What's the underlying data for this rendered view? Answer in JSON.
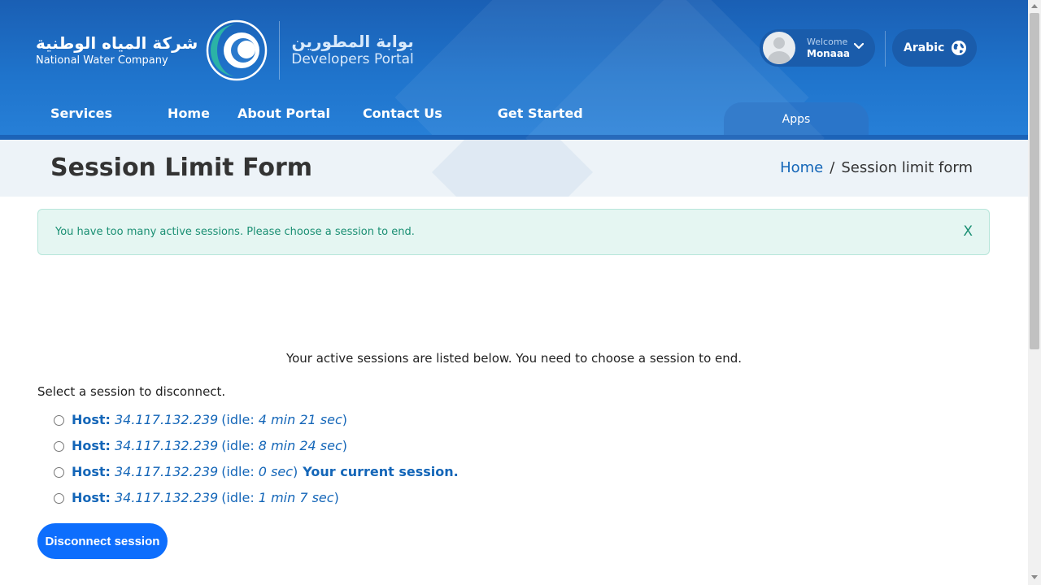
{
  "header": {
    "logo": {
      "company_ar": "شركة المياه الوطنية",
      "company_en": "National Water Company",
      "portal_ar": "بوابة المطورين",
      "portal_en": "Developers Portal"
    },
    "user": {
      "welcome": "Welcome",
      "name": "Monaaa",
      "icon": "chevron-down-icon"
    },
    "language": {
      "label": "Arabic",
      "icon": "globe-icon"
    },
    "nav": [
      "Services",
      "Home",
      "About Portal",
      "Contact Us",
      "Get Started"
    ],
    "apps_tab": "Apps"
  },
  "title_band": {
    "title": "Session Limit Form",
    "breadcrumb": {
      "home": "Home",
      "separator": "/",
      "current": "Session limit form"
    }
  },
  "alert": {
    "message": "You have too many active sessions. Please choose a session to end.",
    "close": "X"
  },
  "content": {
    "intro": "Your active sessions are listed below. You need to choose a session to end.",
    "select_label": "Select a session to disconnect.",
    "sessions": [
      {
        "host_label": "Host:",
        "host": "34.117.132.239",
        "idle_prefix": "(idle: ",
        "idle": "4 min 21 sec",
        "idle_suffix": ")",
        "current": ""
      },
      {
        "host_label": "Host:",
        "host": "34.117.132.239",
        "idle_prefix": "(idle: ",
        "idle": "8 min 24 sec",
        "idle_suffix": ")",
        "current": ""
      },
      {
        "host_label": "Host:",
        "host": "34.117.132.239",
        "idle_prefix": "(idle: ",
        "idle": "0 sec",
        "idle_suffix": ")",
        "current": "Your current session."
      },
      {
        "host_label": "Host:",
        "host": "34.117.132.239",
        "idle_prefix": "(idle: ",
        "idle": "1 min 7 sec",
        "idle_suffix": ")",
        "current": ""
      }
    ],
    "button": "Disconnect session"
  },
  "colors": {
    "header_blue": "#1f74cc",
    "link_blue": "#1466b8",
    "button_blue": "#0d6efd",
    "alert_green": "#1a8f73",
    "alert_bg": "#e5f6f2"
  }
}
